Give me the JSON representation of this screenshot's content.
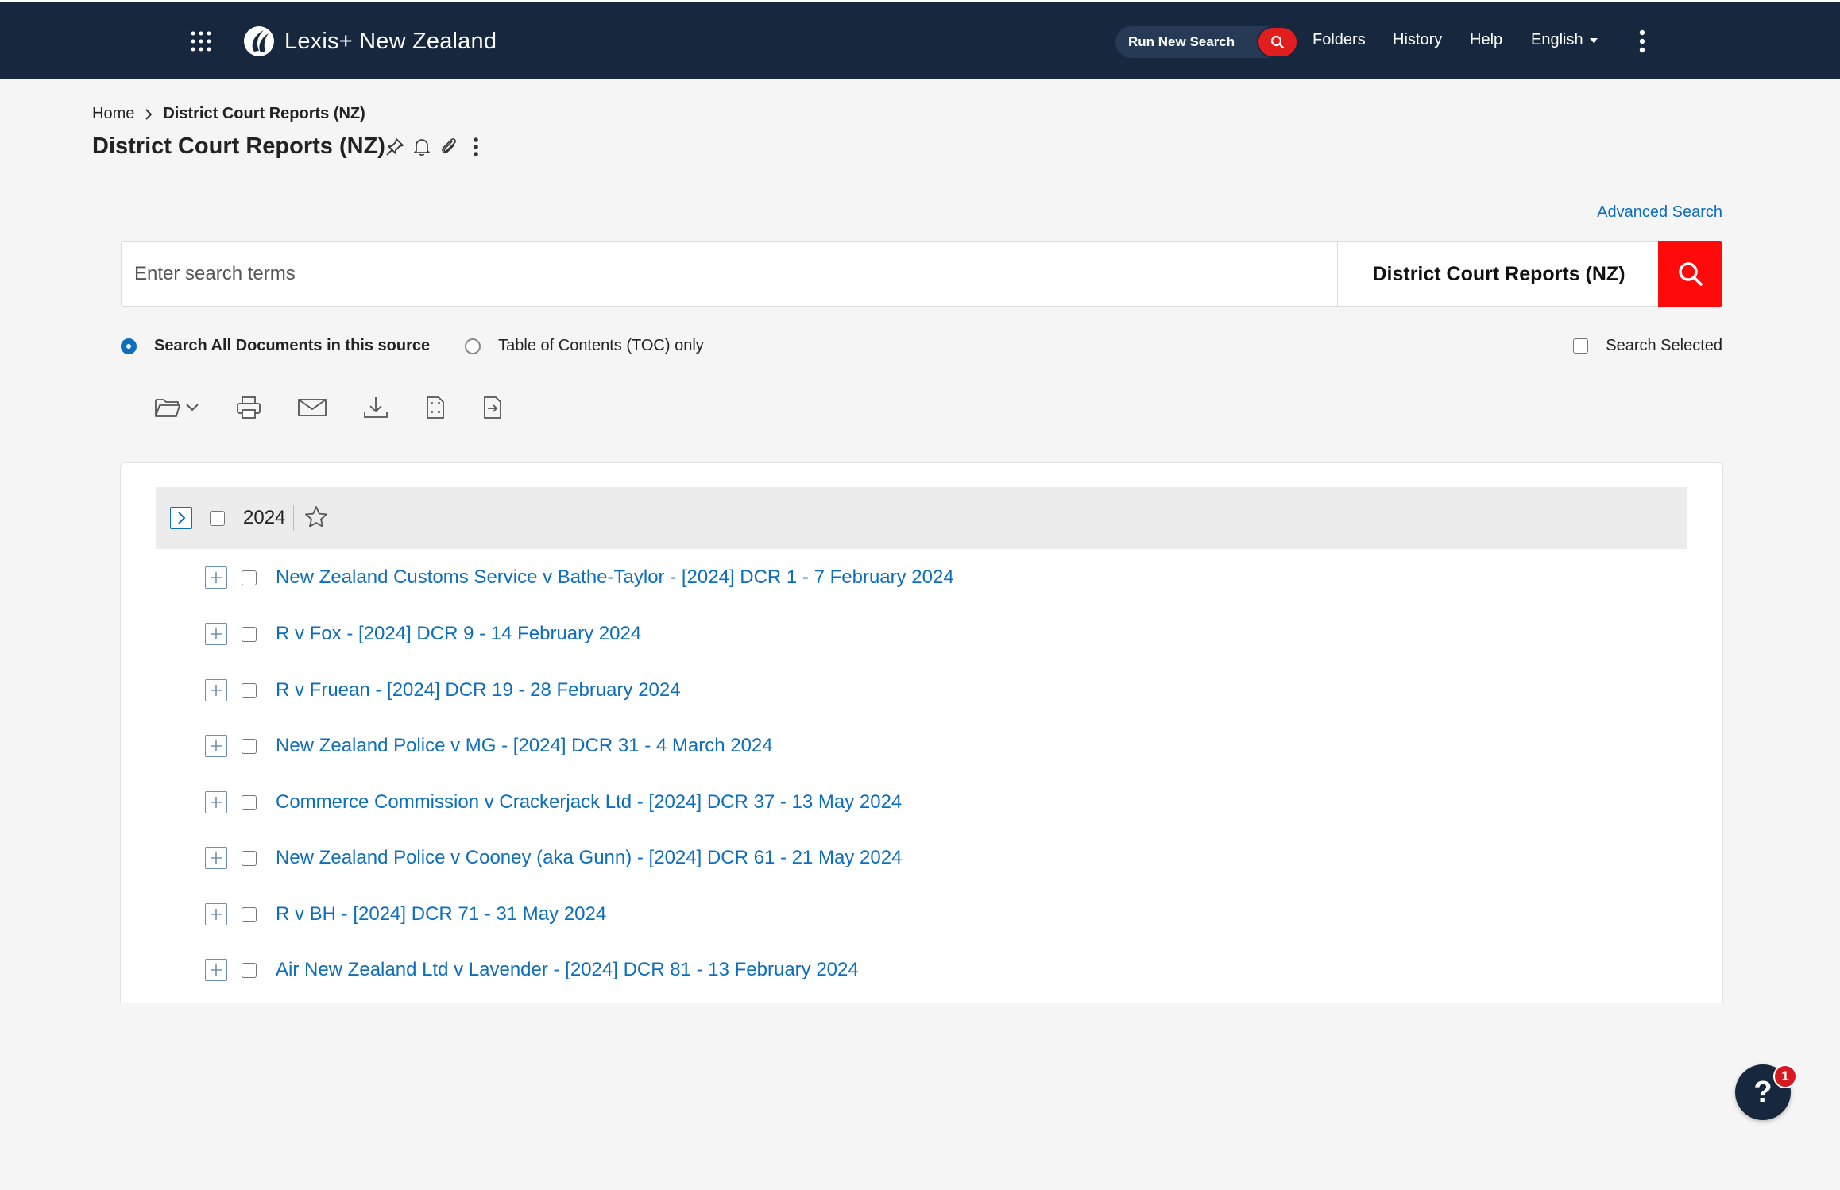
{
  "header": {
    "brand": "Lexis+ New Zealand",
    "run_new_search": "Run New Search",
    "nav": [
      "Folders",
      "History",
      "Help",
      "English"
    ],
    "accent_color": "#e11d1d",
    "bar_color": "#17273d"
  },
  "breadcrumb": {
    "home": "Home",
    "current": "District Court Reports (NZ)"
  },
  "page": {
    "title": "District Court Reports (NZ)",
    "title_icons": [
      "pin-icon",
      "bell-icon",
      "paperclip-icon",
      "more-vertical-icon"
    ]
  },
  "search": {
    "advanced_link": "Advanced Search",
    "placeholder": "Enter search terms",
    "value": "",
    "source": "District Court Reports (NZ)",
    "options": [
      {
        "label": "Search All Documents in this source",
        "checked": true
      },
      {
        "label": "Table of Contents (TOC) only",
        "checked": false
      }
    ],
    "search_selected": "Search Selected"
  },
  "toolbar": {
    "icons": [
      "folder-icon",
      "print-icon",
      "email-icon",
      "download-icon",
      "full-screen-icon",
      "export-icon"
    ]
  },
  "toc": {
    "year": "2024",
    "items": [
      "New Zealand Customs Service v Bathe-Taylor - [2024] DCR 1 - 7 February 2024",
      "R v Fox - [2024] DCR 9 - 14 February 2024",
      "R v Fruean - [2024] DCR 19 - 28 February 2024",
      "New Zealand Police v MG - [2024] DCR 31 - 4 March 2024",
      "Commerce Commission v Crackerjack Ltd - [2024] DCR 37 - 13 May 2024",
      "New Zealand Police v Cooney (aka Gunn) - [2024] DCR 61 - 21 May 2024",
      "R v BH - [2024] DCR 71 - 31 May 2024",
      "Air New Zealand Ltd v Lavender - [2024] DCR 81 - 13 February 2024"
    ]
  },
  "help": {
    "symbol": "?",
    "badge": "1"
  }
}
